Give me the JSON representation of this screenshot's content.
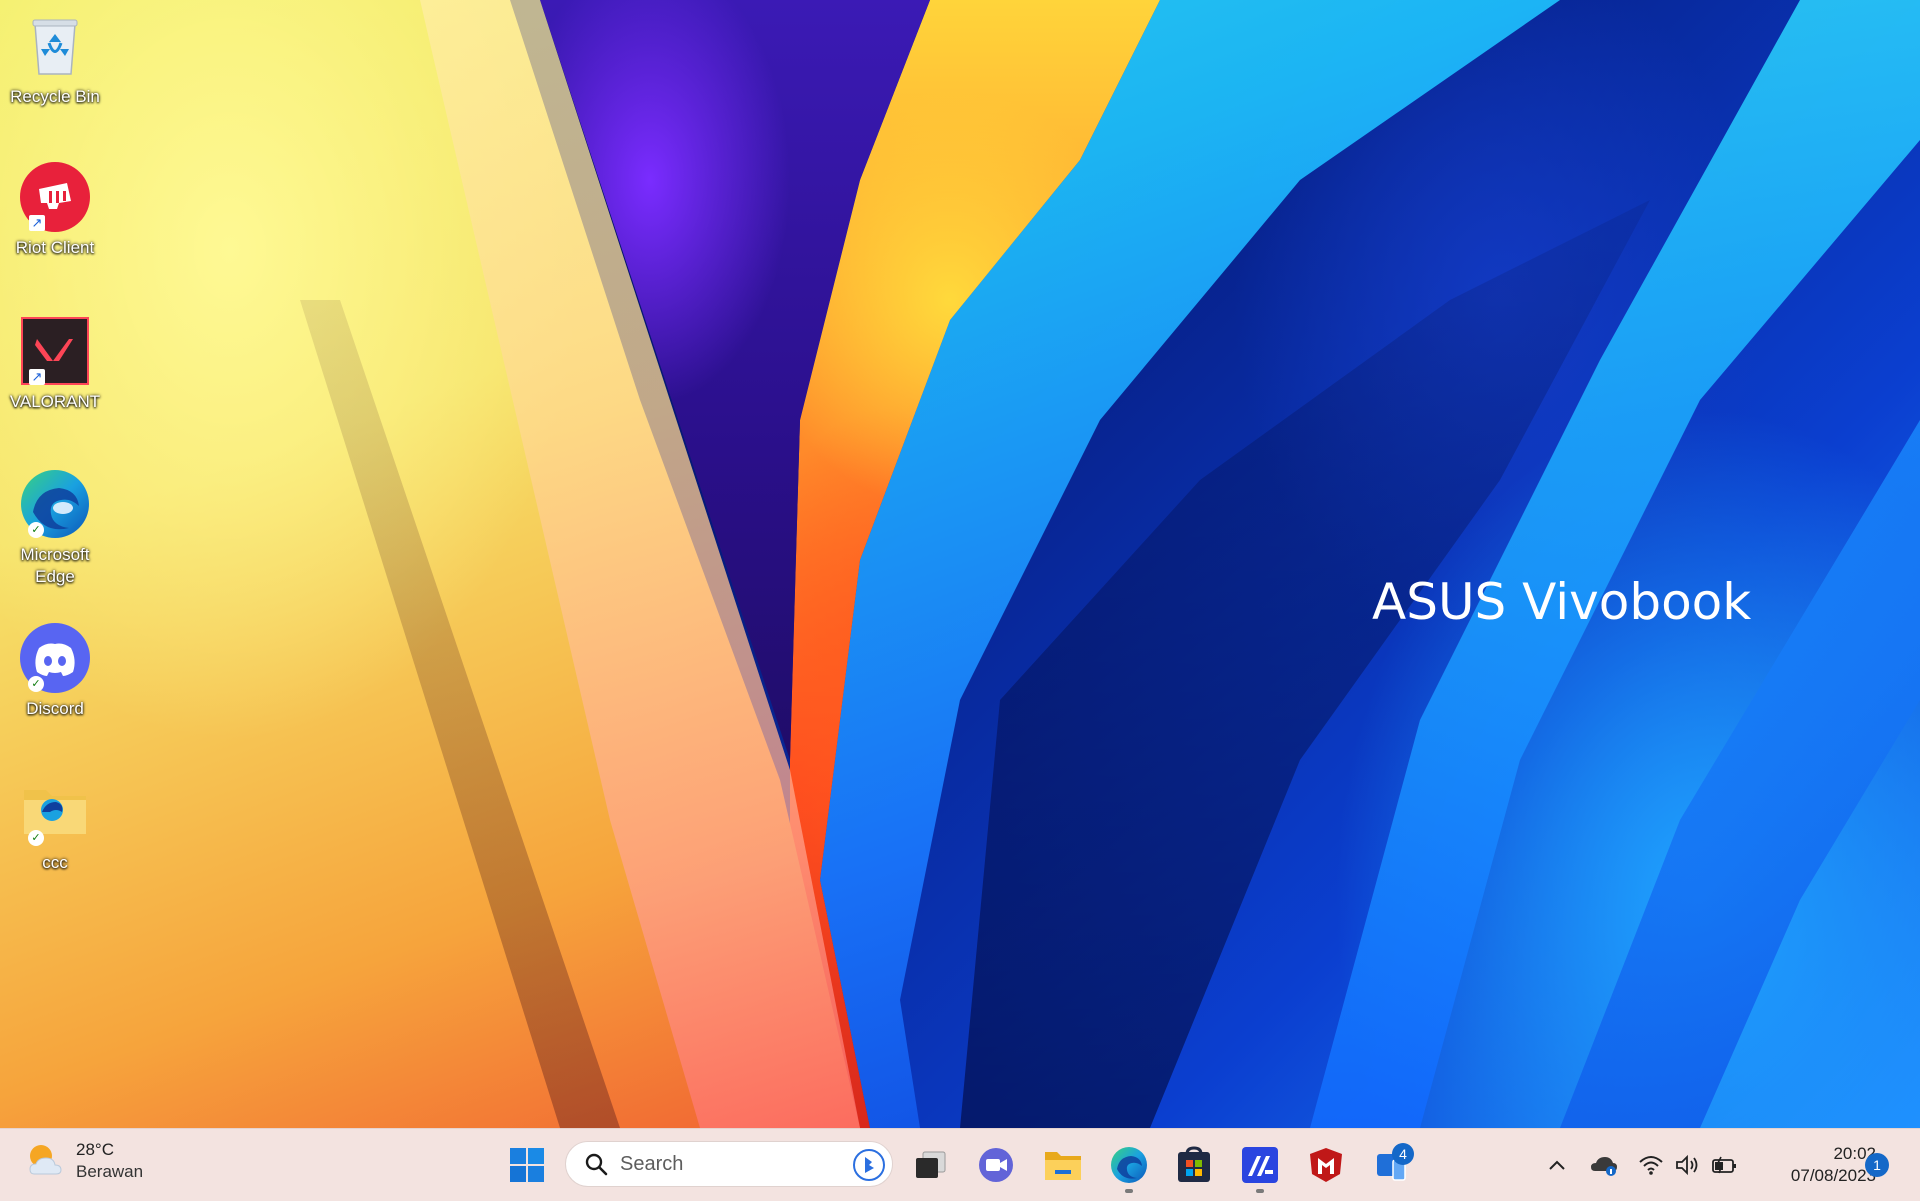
{
  "wallpaper": {
    "brand_text": "ASUS Vivobook"
  },
  "desktop_icons": [
    {
      "label": "Recycle Bin",
      "icon": "recycle-bin-icon",
      "overlay": "none"
    },
    {
      "label": "Riot Client",
      "icon": "riot-client-icon",
      "overlay": "shortcut",
      "color": "#e8213b"
    },
    {
      "label": "VALORANT",
      "icon": "valorant-icon",
      "overlay": "shortcut",
      "color": "#fd4556"
    },
    {
      "label": "Microsoft Edge",
      "icon": "edge-icon",
      "overlay": "synced"
    },
    {
      "label": "Discord",
      "icon": "discord-icon",
      "overlay": "synced",
      "color": "#5865f2"
    },
    {
      "label": "ccc",
      "icon": "folder-icon",
      "overlay": "synced"
    }
  ],
  "taskbar": {
    "weather": {
      "temperature": "28°C",
      "condition": "Berawan",
      "icon": "partly-cloudy-icon"
    },
    "search": {
      "placeholder": "Search"
    },
    "pinned": [
      {
        "name": "start",
        "icon": "windows-start-icon"
      },
      {
        "name": "task-view",
        "icon": "task-view-icon"
      },
      {
        "name": "teams-chat",
        "icon": "teams-meet-icon"
      },
      {
        "name": "file-explorer",
        "icon": "file-explorer-icon"
      },
      {
        "name": "edge",
        "icon": "edge-icon",
        "running": true
      },
      {
        "name": "microsoft-store",
        "icon": "store-icon"
      },
      {
        "name": "myasus",
        "icon": "myasus-icon",
        "running": true
      },
      {
        "name": "mcafee",
        "icon": "mcafee-icon"
      },
      {
        "name": "phone-link",
        "icon": "phone-link-icon",
        "badge": "4"
      }
    ],
    "tray": {
      "icons": [
        "chevron-up-icon",
        "onedrive-icon",
        "wifi-icon",
        "volume-icon",
        "battery-icon"
      ],
      "time": "20:02",
      "date": "07/08/2023",
      "notification_count": "1"
    }
  }
}
